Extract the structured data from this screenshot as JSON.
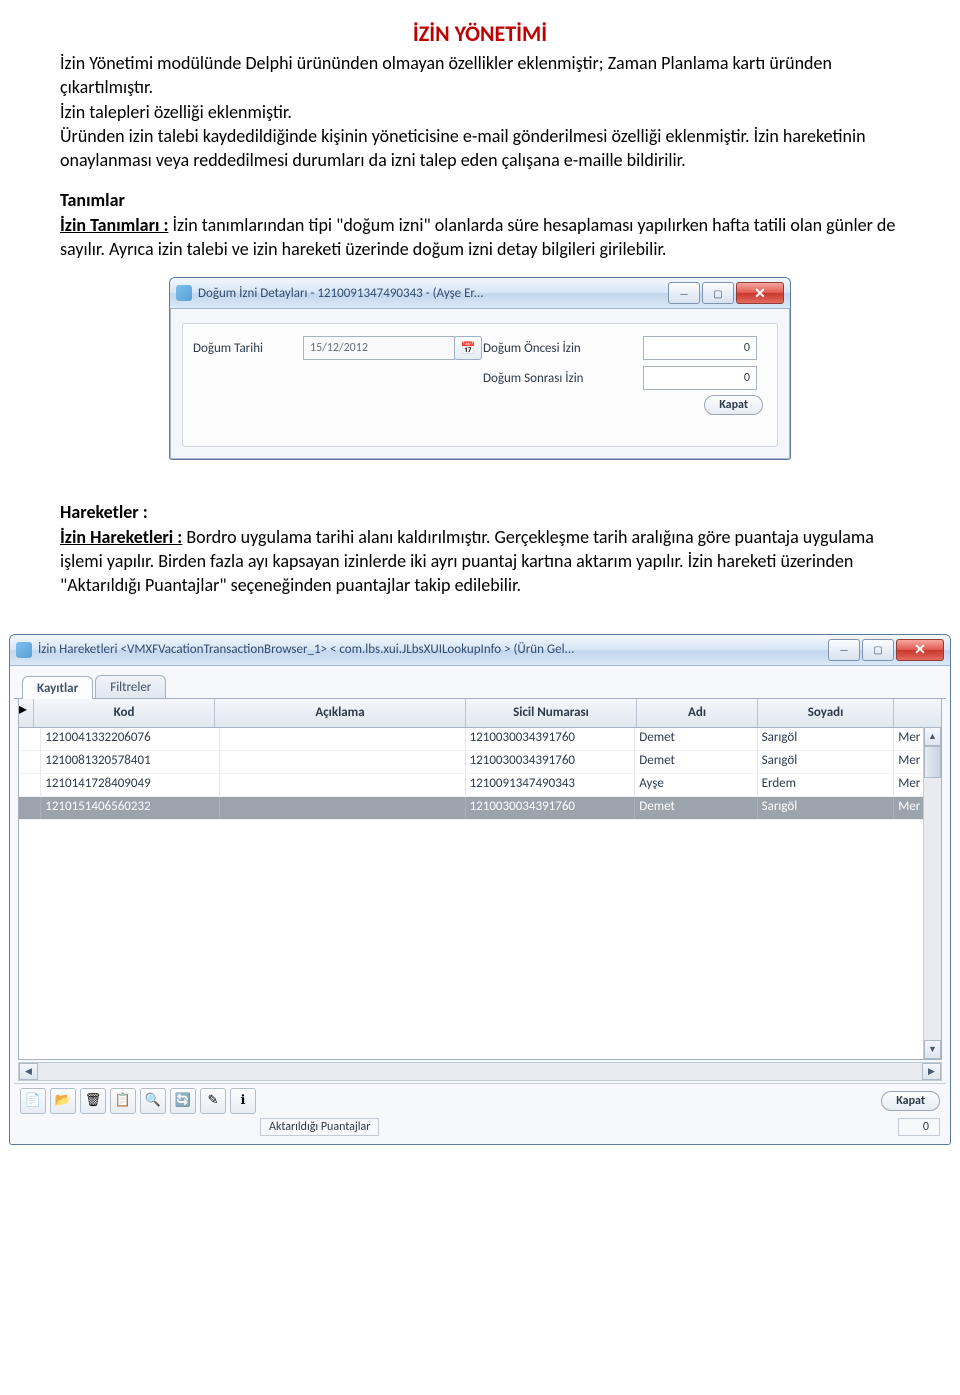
{
  "title": "İZİN YÖNETİMİ",
  "intro": "İzin Yönetimi modülünde Delphi ürününden olmayan özellikler eklenmiştir; Zaman Planlama kartı üründen çıkartılmıştır.\nİzin talepleri özelliği eklenmiştir.\nÜründen izin talebi kaydedildiğinde kişinin yöneticisine e-mail gönderilmesi özelliği eklenmiştir. İzin hareketinin onaylanması veya reddedilmesi durumları da izni talep eden çalışana e-maille bildirilir.",
  "tanimlar_head": "Tanımlar",
  "izin_tanimlari_label": "İzin Tanımları :",
  "izin_tanimlari_text": " İzin tanımlarından tipi \"doğum izni\" olanlarda süre hesaplaması yapılırken hafta tatili olan günler de sayılır. Ayrıca izin talebi ve izin hareketi üzerinde doğum izni detay bilgileri girilebilir.",
  "dialog1": {
    "caption": "Doğum İzni Detayları - 1210091347490343 - (Ayşe Er...",
    "dogum_tarihi_label": "Doğum Tarihi",
    "dogum_tarihi_value": "15/12/2012",
    "oncesi_label": "Doğum Öncesi İzin",
    "oncesi_value": "0",
    "sonrasi_label": "Doğum Sonrası İzin",
    "sonrasi_value": "0",
    "kapat": "Kapat"
  },
  "hareketler_head": "Hareketler :",
  "izin_hareketleri_label": "İzin Hareketleri :",
  "izin_hareketleri_text": " Bordro uygulama tarihi alanı kaldırılmıştır. Gerçekleşme tarih aralığına göre puantaja uygulama işlemi yapılır. Birden fazla ayı kapsayan izinlerde iki ayrı puantaj kartına aktarım yapılır. İzin hareketi üzerinden \"Aktarıldığı Puantajlar\" seçeneğinden puantajlar takip edilebilir.",
  "window2": {
    "caption": "İzin Hareketleri <VMXFVacationTransactionBrowser_1> < com.lbs.xui.JLbsXUILookupInfo > (Ürün Gel...",
    "tabs": {
      "kayitlar": "Kayıtlar",
      "filtreler": "Filtreler"
    },
    "columns": {
      "kod": "Kod",
      "aciklama": "Açıklama",
      "sicil": "Sicil Numarası",
      "adi": "Adı",
      "soyadi": "Soyadı"
    },
    "rows": [
      {
        "kod": "1210041332206076",
        "aciklama": "",
        "sicil": "1210030034391760",
        "adi": "Demet",
        "soyadi": "Sarıgöl",
        "last": "Mer"
      },
      {
        "kod": "1210081320578401",
        "aciklama": "",
        "sicil": "1210030034391760",
        "adi": "Demet",
        "soyadi": "Sarıgöl",
        "last": "Mer"
      },
      {
        "kod": "1210141728409049",
        "aciklama": "",
        "sicil": "1210091347490343",
        "adi": "Ayşe",
        "soyadi": "Erdem",
        "last": "Mer"
      },
      {
        "kod": "1210151406560232",
        "aciklama": "",
        "sicil": "1210030034391760",
        "adi": "Demet",
        "soyadi": "Sarıgöl",
        "last": "Mer"
      }
    ],
    "kapat": "Kapat",
    "status_label": "Aktarıldığı Puantajlar",
    "status_count": "0"
  }
}
